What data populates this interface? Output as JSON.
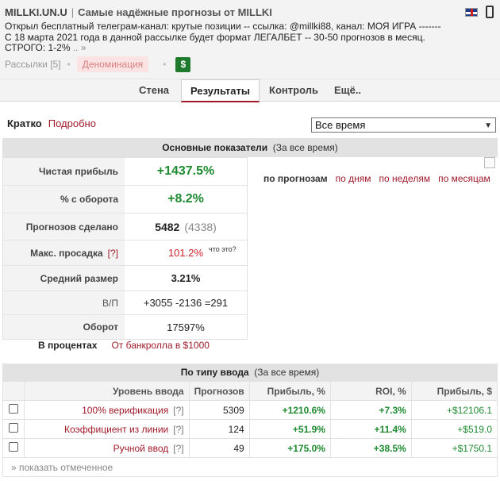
{
  "header": {
    "site": "MILLKI.UN.U",
    "separator": "|",
    "tagline": "Самые надёжные прогнозы от MILLKI",
    "description": "Открыл бесплатный телеграм-канал: крутые позиции -- ссылка: @millki88, канал: МОЯ ИГРА ------- С 18 марта 2021 года в данной рассылке будет формат ЛЕГАЛБЕТ -- 30-50 прогнозов в месяц. СТРОГО: 1-2%",
    "more": " .. »",
    "mailings": "Рассылки [5]",
    "denomination": "Деноминация",
    "dollar": "$"
  },
  "tabs": [
    {
      "label": "Стена"
    },
    {
      "label": "Результаты"
    },
    {
      "label": "Контроль"
    },
    {
      "label": "Ещё.."
    }
  ],
  "filter": {
    "short": "Кратко",
    "detailed": "Подробно",
    "period": "Все время"
  },
  "main": {
    "title": "Основные показатели",
    "subtitle": "(За все время)",
    "rows": [
      {
        "label": "Чистая прибыль",
        "value": "+1437.5%"
      },
      {
        "label": "% с оборота",
        "value": "+8.2%"
      },
      {
        "label": "Прогнозов сделано",
        "value": "5482",
        "extra": "(4338)"
      },
      {
        "label": "Макс. просадка",
        "help": "[?]",
        "value": "101.2%",
        "note": "что это?"
      },
      {
        "label": "Средний размер",
        "value": "3.21%"
      },
      {
        "label": "В/П",
        "value": "+3055 -2136 =291"
      },
      {
        "label": "Оборот",
        "value": "17597%"
      }
    ],
    "percent_label": "В процентах",
    "percent_link": "От банкролла в $1000"
  },
  "chart_tabs": [
    "по прогнозам",
    "по дням",
    "по неделям",
    "по месяцам"
  ],
  "entry": {
    "title": "По типу ввода",
    "subtitle": "(За все время)",
    "headers": [
      "Уровень ввода",
      "Прогнозов",
      "Прибыль, %",
      "ROI, %",
      "Прибыль, $"
    ],
    "rows": [
      {
        "name": "100% верификация",
        "help": "[?]",
        "count": "5309",
        "profit_pct": "+1210.6%",
        "roi": "+7.3%",
        "profit_usd": "+$12106.1"
      },
      {
        "name": "Коэффициент из линии",
        "help": "[?]",
        "count": "124",
        "profit_pct": "+51.9%",
        "roi": "+11.4%",
        "profit_usd": "+$519.0"
      },
      {
        "name": "Ручной ввод",
        "help": "[?]",
        "count": "49",
        "profit_pct": "+175.0%",
        "roi": "+38.5%",
        "profit_usd": "+$1750.1"
      }
    ],
    "show_selected": "» показать отмеченное"
  }
}
